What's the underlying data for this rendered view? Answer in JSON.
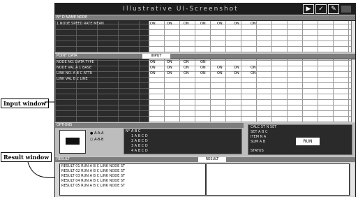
{
  "annotations": {
    "input_label": "Input window",
    "result_label": "Result window"
  },
  "titlebar": {
    "title": "Illustrative UI-Screenshot"
  },
  "top_panel": {
    "header": "N° D NAME NODE",
    "row": "1  NODE  SPEED  RATE  MEAN",
    "values": [
      "ON",
      "ON",
      "ON",
      "ON",
      "ON",
      "ON",
      "ON"
    ]
  },
  "middle_panel": {
    "header": "POINT  DATA",
    "tab_label": "INPUT",
    "rows": [
      "NODE  NO.  DATA  TYPE",
      "NODE  VAL  A 1  BASE",
      "LINK  NO.  A B C  ATTR",
      "LINK  VAL  B 2  LINE"
    ],
    "cells": [
      [
        "ON",
        "ON",
        "ON",
        "ON"
      ],
      [
        "ON",
        "ON",
        "ON",
        "ON",
        "ON",
        "ON",
        "ON"
      ],
      [
        "ON",
        "ON",
        "ON",
        "ON",
        "ON",
        "ON",
        "ON"
      ]
    ]
  },
  "options_panel": {
    "header": "OPTIONS",
    "radio_a": "A-A-A",
    "radio_b": "A-B-B",
    "table_header": "N°  A  B  C",
    "table_rows": [
      "1  A  B  C  D",
      "2  A  B  C  D",
      "3  A  B  C  D",
      "4  A  B  C  D"
    ]
  },
  "info_panel": {
    "lines": [
      "CALC  ST  N  SET",
      "SET  A  B  C",
      "ITEM  N  A",
      "SUM  A  B"
    ],
    "badge": "RUN",
    "footer": "STATUS"
  },
  "result_panel": {
    "header": "RESULT",
    "tab_label": "RESULT",
    "rows": [
      "RESULT  01  RUN  A  B  C  LINK  NODE  ST",
      "RESULT  02  RUN  A  B  C  LINK  NODE  ST",
      "RESULT  03  RUN  A  B  C  LINK  NODE  ST",
      "RESULT  04  RUN  A  B  C  LINK  NODE  ST",
      "RESULT  05  RUN  A  B  C  LINK  NODE  ST"
    ]
  },
  "icons": [
    "play-icon",
    "check-icon",
    "tool-icon"
  ]
}
